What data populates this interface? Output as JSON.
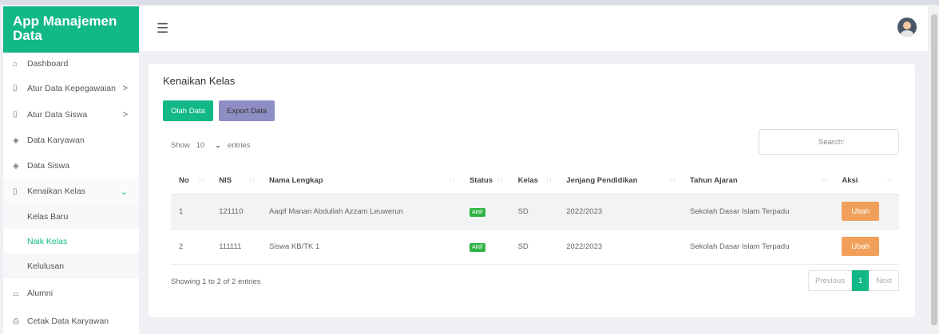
{
  "sidebar": {
    "brand": "App Manajemen Data",
    "items": [
      {
        "label": "Dashboard",
        "icon": "home-icon"
      },
      {
        "label": "Atur Data Kepegawaian",
        "icon": "folder-icon",
        "chevron": ">"
      },
      {
        "label": "Atur Data Siswa",
        "icon": "folder-icon",
        "chevron": ">"
      },
      {
        "label": "Data Karyawan",
        "icon": "layers-icon"
      },
      {
        "label": "Data Siswa",
        "icon": "layers-icon"
      },
      {
        "label": "Kenaikan Kelas",
        "icon": "folder-icon",
        "chevron": "⌄"
      }
    ],
    "sub_items": [
      "Kelas Baru",
      "Naik Kelas",
      "Kelulusan"
    ],
    "items_after": [
      {
        "label": "Alumni",
        "icon": "graduation-icon"
      },
      {
        "label": "Cetak Data Karyawan",
        "icon": "print-icon"
      }
    ]
  },
  "header": {
    "menu_icon": "hamburger-icon",
    "avatar_icon": "user-avatar-icon"
  },
  "card": {
    "title": "Kenaikan Kelas",
    "olah_label": "Olah Data",
    "export_label": "Export Data",
    "show_label": "Show",
    "entries_value": "10",
    "entries_label": "entries",
    "search_label": "Search:",
    "columns": [
      "No",
      "NIS",
      "Nama Lengkap",
      "Status",
      "Kelas",
      "Jenjang Pendidikan",
      "Tahun Ajaran",
      "Aksi"
    ],
    "rows": [
      {
        "no": "1",
        "nis": "121110",
        "nama": "Aaqif Manan Abdullah Azzam Leuwerun",
        "status": "Aktif",
        "kelas": "SD",
        "jenjang": "2022/2023",
        "tahun": "Sekolah Dasar Islam Terpadu",
        "aksi": "Ubah"
      },
      {
        "no": "2",
        "nis": "111111",
        "nama": "Siswa KB/TK 1",
        "status": "Aktif",
        "kelas": "SD",
        "jenjang": "2022/2023",
        "tahun": "Sekolah Dasar Islam Terpadu",
        "aksi": "Ubah"
      }
    ],
    "showing": "Showing 1 to 2 of 2 entries",
    "pager": {
      "prev": "Previous",
      "current": "1",
      "next": "Next"
    }
  },
  "colors": {
    "accent": "#12b886",
    "export": "#8e8ec4",
    "ubah": "#f0a05a",
    "badge": "#2fb344"
  }
}
